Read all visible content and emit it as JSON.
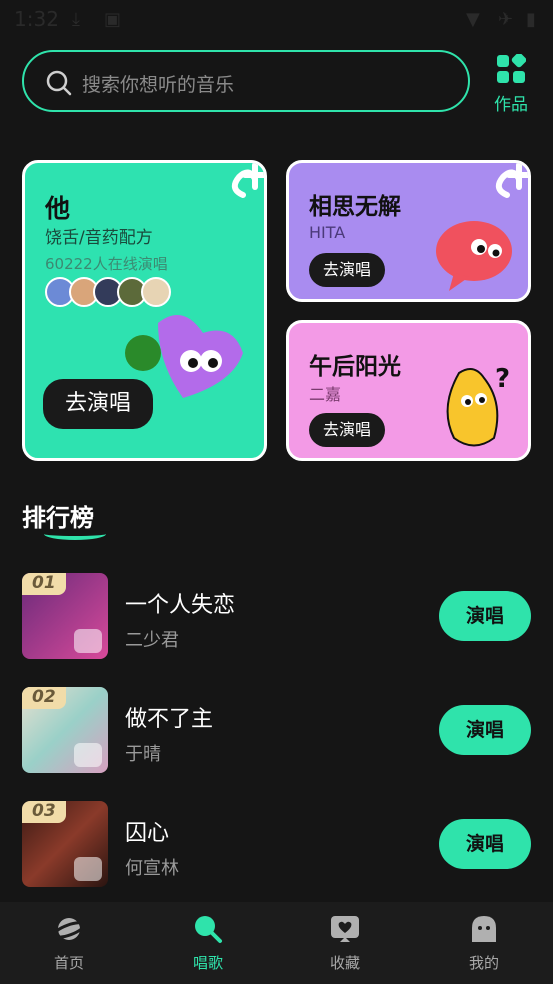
{
  "status": {
    "time": "1:32"
  },
  "search": {
    "placeholder": "搜索你想听的音乐"
  },
  "works": {
    "label": "作品"
  },
  "featured": {
    "main": {
      "title": "他",
      "subtitle": "饶舌/音药配方",
      "singing_count": "60222人在线演唱",
      "button": "去演唱"
    },
    "card2": {
      "title": "相思无解",
      "artist": "HITA",
      "button": "去演唱"
    },
    "card3": {
      "title": "午后阳光",
      "artist": "二嘉",
      "button": "去演唱"
    }
  },
  "ranking": {
    "title": "排行榜",
    "items": [
      {
        "rank": "01",
        "song": "一个人失恋",
        "artist": "二少君",
        "button": "演唱"
      },
      {
        "rank": "02",
        "song": "做不了主",
        "artist": "于晴",
        "button": "演唱"
      },
      {
        "rank": "03",
        "song": "囚心",
        "artist": "何宣林",
        "button": "演唱"
      }
    ]
  },
  "nav": {
    "items": [
      {
        "label": "首页",
        "icon": "planet-icon"
      },
      {
        "label": "唱歌",
        "icon": "microphone-icon"
      },
      {
        "label": "收藏",
        "icon": "heart-chat-icon"
      },
      {
        "label": "我的",
        "icon": "ghost-icon"
      }
    ]
  },
  "colors": {
    "accent": "#2fe3ab",
    "background": "#151515",
    "card1": "#2ee2b0",
    "card2": "#a98cf0",
    "card3": "#f39ae6"
  }
}
